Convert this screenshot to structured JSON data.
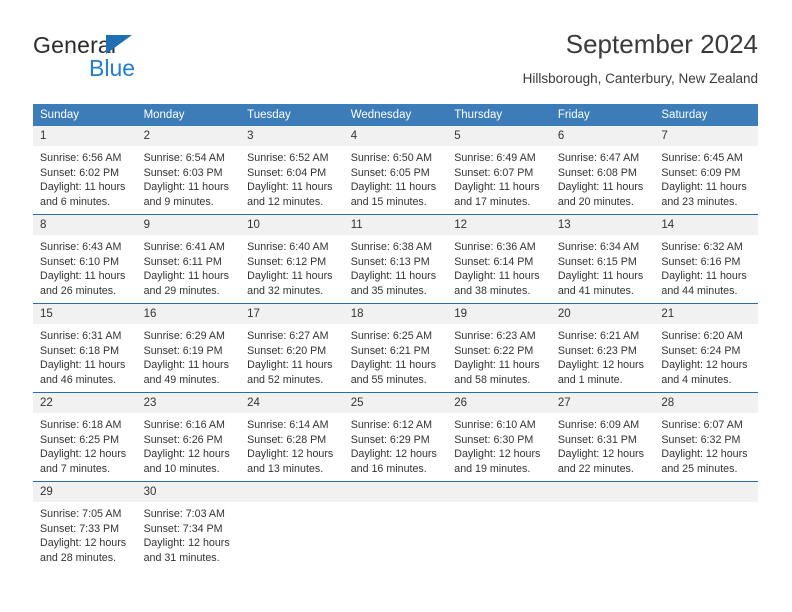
{
  "brand": {
    "name_part1": "General",
    "name_part2": "Blue",
    "logo_icon": "triangle-logo-icon",
    "accent_color": "#1f7fd0"
  },
  "header": {
    "title": "September 2024",
    "subtitle": "Hillsborough, Canterbury, New Zealand"
  },
  "calendar": {
    "header_bg_color": "#3b7cb9",
    "row_divider_color": "#2e6da4",
    "daynum_bg_color": "#f1f1f1",
    "weekdays": [
      "Sunday",
      "Monday",
      "Tuesday",
      "Wednesday",
      "Thursday",
      "Friday",
      "Saturday"
    ],
    "weeks": [
      [
        {
          "day": "1",
          "sunrise": "Sunrise: 6:56 AM",
          "sunset": "Sunset: 6:02 PM",
          "daylight_line1": "Daylight: 11 hours",
          "daylight_line2": "and 6 minutes."
        },
        {
          "day": "2",
          "sunrise": "Sunrise: 6:54 AM",
          "sunset": "Sunset: 6:03 PM",
          "daylight_line1": "Daylight: 11 hours",
          "daylight_line2": "and 9 minutes."
        },
        {
          "day": "3",
          "sunrise": "Sunrise: 6:52 AM",
          "sunset": "Sunset: 6:04 PM",
          "daylight_line1": "Daylight: 11 hours",
          "daylight_line2": "and 12 minutes."
        },
        {
          "day": "4",
          "sunrise": "Sunrise: 6:50 AM",
          "sunset": "Sunset: 6:05 PM",
          "daylight_line1": "Daylight: 11 hours",
          "daylight_line2": "and 15 minutes."
        },
        {
          "day": "5",
          "sunrise": "Sunrise: 6:49 AM",
          "sunset": "Sunset: 6:07 PM",
          "daylight_line1": "Daylight: 11 hours",
          "daylight_line2": "and 17 minutes."
        },
        {
          "day": "6",
          "sunrise": "Sunrise: 6:47 AM",
          "sunset": "Sunset: 6:08 PM",
          "daylight_line1": "Daylight: 11 hours",
          "daylight_line2": "and 20 minutes."
        },
        {
          "day": "7",
          "sunrise": "Sunrise: 6:45 AM",
          "sunset": "Sunset: 6:09 PM",
          "daylight_line1": "Daylight: 11 hours",
          "daylight_line2": "and 23 minutes."
        }
      ],
      [
        {
          "day": "8",
          "sunrise": "Sunrise: 6:43 AM",
          "sunset": "Sunset: 6:10 PM",
          "daylight_line1": "Daylight: 11 hours",
          "daylight_line2": "and 26 minutes."
        },
        {
          "day": "9",
          "sunrise": "Sunrise: 6:41 AM",
          "sunset": "Sunset: 6:11 PM",
          "daylight_line1": "Daylight: 11 hours",
          "daylight_line2": "and 29 minutes."
        },
        {
          "day": "10",
          "sunrise": "Sunrise: 6:40 AM",
          "sunset": "Sunset: 6:12 PM",
          "daylight_line1": "Daylight: 11 hours",
          "daylight_line2": "and 32 minutes."
        },
        {
          "day": "11",
          "sunrise": "Sunrise: 6:38 AM",
          "sunset": "Sunset: 6:13 PM",
          "daylight_line1": "Daylight: 11 hours",
          "daylight_line2": "and 35 minutes."
        },
        {
          "day": "12",
          "sunrise": "Sunrise: 6:36 AM",
          "sunset": "Sunset: 6:14 PM",
          "daylight_line1": "Daylight: 11 hours",
          "daylight_line2": "and 38 minutes."
        },
        {
          "day": "13",
          "sunrise": "Sunrise: 6:34 AM",
          "sunset": "Sunset: 6:15 PM",
          "daylight_line1": "Daylight: 11 hours",
          "daylight_line2": "and 41 minutes."
        },
        {
          "day": "14",
          "sunrise": "Sunrise: 6:32 AM",
          "sunset": "Sunset: 6:16 PM",
          "daylight_line1": "Daylight: 11 hours",
          "daylight_line2": "and 44 minutes."
        }
      ],
      [
        {
          "day": "15",
          "sunrise": "Sunrise: 6:31 AM",
          "sunset": "Sunset: 6:18 PM",
          "daylight_line1": "Daylight: 11 hours",
          "daylight_line2": "and 46 minutes."
        },
        {
          "day": "16",
          "sunrise": "Sunrise: 6:29 AM",
          "sunset": "Sunset: 6:19 PM",
          "daylight_line1": "Daylight: 11 hours",
          "daylight_line2": "and 49 minutes."
        },
        {
          "day": "17",
          "sunrise": "Sunrise: 6:27 AM",
          "sunset": "Sunset: 6:20 PM",
          "daylight_line1": "Daylight: 11 hours",
          "daylight_line2": "and 52 minutes."
        },
        {
          "day": "18",
          "sunrise": "Sunrise: 6:25 AM",
          "sunset": "Sunset: 6:21 PM",
          "daylight_line1": "Daylight: 11 hours",
          "daylight_line2": "and 55 minutes."
        },
        {
          "day": "19",
          "sunrise": "Sunrise: 6:23 AM",
          "sunset": "Sunset: 6:22 PM",
          "daylight_line1": "Daylight: 11 hours",
          "daylight_line2": "and 58 minutes."
        },
        {
          "day": "20",
          "sunrise": "Sunrise: 6:21 AM",
          "sunset": "Sunset: 6:23 PM",
          "daylight_line1": "Daylight: 12 hours",
          "daylight_line2": "and 1 minute."
        },
        {
          "day": "21",
          "sunrise": "Sunrise: 6:20 AM",
          "sunset": "Sunset: 6:24 PM",
          "daylight_line1": "Daylight: 12 hours",
          "daylight_line2": "and 4 minutes."
        }
      ],
      [
        {
          "day": "22",
          "sunrise": "Sunrise: 6:18 AM",
          "sunset": "Sunset: 6:25 PM",
          "daylight_line1": "Daylight: 12 hours",
          "daylight_line2": "and 7 minutes."
        },
        {
          "day": "23",
          "sunrise": "Sunrise: 6:16 AM",
          "sunset": "Sunset: 6:26 PM",
          "daylight_line1": "Daylight: 12 hours",
          "daylight_line2": "and 10 minutes."
        },
        {
          "day": "24",
          "sunrise": "Sunrise: 6:14 AM",
          "sunset": "Sunset: 6:28 PM",
          "daylight_line1": "Daylight: 12 hours",
          "daylight_line2": "and 13 minutes."
        },
        {
          "day": "25",
          "sunrise": "Sunrise: 6:12 AM",
          "sunset": "Sunset: 6:29 PM",
          "daylight_line1": "Daylight: 12 hours",
          "daylight_line2": "and 16 minutes."
        },
        {
          "day": "26",
          "sunrise": "Sunrise: 6:10 AM",
          "sunset": "Sunset: 6:30 PM",
          "daylight_line1": "Daylight: 12 hours",
          "daylight_line2": "and 19 minutes."
        },
        {
          "day": "27",
          "sunrise": "Sunrise: 6:09 AM",
          "sunset": "Sunset: 6:31 PM",
          "daylight_line1": "Daylight: 12 hours",
          "daylight_line2": "and 22 minutes."
        },
        {
          "day": "28",
          "sunrise": "Sunrise: 6:07 AM",
          "sunset": "Sunset: 6:32 PM",
          "daylight_line1": "Daylight: 12 hours",
          "daylight_line2": "and 25 minutes."
        }
      ],
      [
        {
          "day": "29",
          "sunrise": "Sunrise: 7:05 AM",
          "sunset": "Sunset: 7:33 PM",
          "daylight_line1": "Daylight: 12 hours",
          "daylight_line2": "and 28 minutes."
        },
        {
          "day": "30",
          "sunrise": "Sunrise: 7:03 AM",
          "sunset": "Sunset: 7:34 PM",
          "daylight_line1": "Daylight: 12 hours",
          "daylight_line2": "and 31 minutes."
        },
        {
          "day": "",
          "sunrise": "",
          "sunset": "",
          "daylight_line1": "",
          "daylight_line2": ""
        },
        {
          "day": "",
          "sunrise": "",
          "sunset": "",
          "daylight_line1": "",
          "daylight_line2": ""
        },
        {
          "day": "",
          "sunrise": "",
          "sunset": "",
          "daylight_line1": "",
          "daylight_line2": ""
        },
        {
          "day": "",
          "sunrise": "",
          "sunset": "",
          "daylight_line1": "",
          "daylight_line2": ""
        },
        {
          "day": "",
          "sunrise": "",
          "sunset": "",
          "daylight_line1": "",
          "daylight_line2": ""
        }
      ]
    ]
  }
}
